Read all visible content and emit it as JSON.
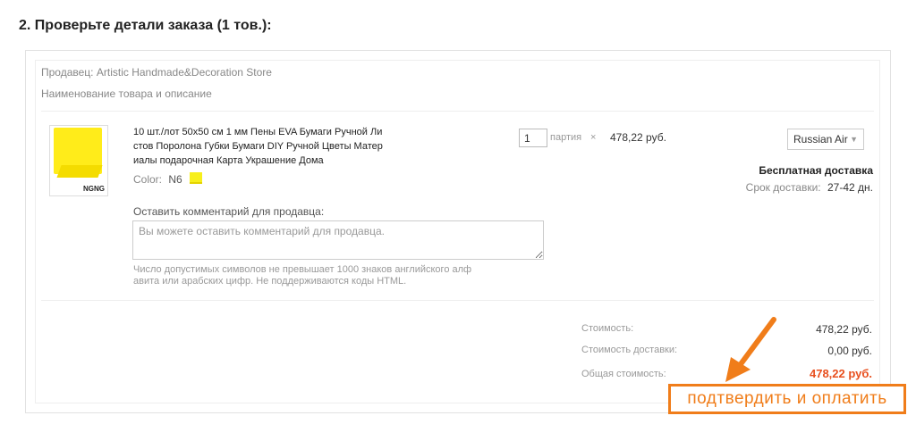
{
  "section": {
    "title": "2. Проверьте детали заказа (1 тов.):"
  },
  "seller": {
    "label": "Продавец:",
    "name": "Artistic Handmade&Decoration Store"
  },
  "item_header": "Наименование товара и описание",
  "product": {
    "title_lines": [
      "10 шт./лот 50x50 см 1 мм Пены EVA Бумаги Ручной Ли",
      "стов Поролона Губки Бумаги DIY Ручной Цветы Матер",
      "иалы подарочная Карта Украшение Дома"
    ],
    "color_label": "Color:",
    "color_value": "N6",
    "swatch_color": "#f7ef1c",
    "thumb_tag": "NGNG",
    "quantity": "1",
    "unit": "партия",
    "times": "×",
    "unit_price": "478,22 руб."
  },
  "comment": {
    "label": "Оставить комментарий для продавца:",
    "placeholder": "Вы можете оставить комментарий для продавца.",
    "hint_lines": [
      "Число допустимых символов не превышает 1000 знаков английского алф",
      "авита или арабских цифр. Не поддерживаются коды HTML."
    ]
  },
  "shipping": {
    "method": "Russian Air",
    "free_label": "Бесплатная доставка",
    "delivery_label": "Срок доставки:",
    "delivery_days": "27-42 дн."
  },
  "summary": {
    "cost_label": "Стоимость:",
    "cost_value": "478,22 руб.",
    "shipping_label": "Стоимость доставки:",
    "shipping_value": "0,00 руб.",
    "total_label": "Общая стоимость:",
    "total_value": "478,22 руб."
  },
  "pay_button": "подтвердить и оплатить",
  "colors": {
    "accent": "#f07d1a",
    "total": "#e8501f"
  }
}
